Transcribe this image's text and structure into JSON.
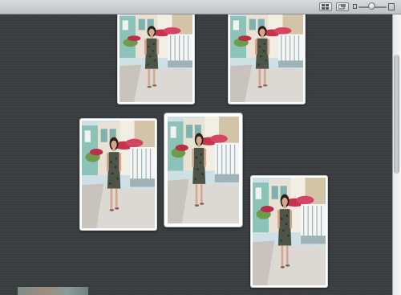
{
  "window": {
    "toolbar_buttons": [
      {
        "name": "view-mode-button",
        "icon": "grid-icon"
      },
      {
        "name": "stack-view-button",
        "icon": "stack-icon"
      }
    ],
    "zoom_slider": {
      "value": 0.45,
      "min_icon": "small-photo-icon",
      "max_icon": "large-photo-icon"
    }
  },
  "photos": [
    {
      "id": "photo-1",
      "subject": "woman-in-dress-walking",
      "selected": false
    },
    {
      "id": "photo-2",
      "subject": "woman-in-dress-walking",
      "selected": false
    },
    {
      "id": "photo-3",
      "subject": "woman-in-dress-walking",
      "selected": false
    },
    {
      "id": "photo-4",
      "subject": "woman-in-dress-walking",
      "selected": true
    },
    {
      "id": "photo-5",
      "subject": "woman-in-dress-walking",
      "selected": false
    }
  ],
  "scrollbar": {
    "position": 0.15
  },
  "colors": {
    "canvas": "#3b3e40",
    "toolbar": "#cfd2d5",
    "photo_border": "#ffffff",
    "sky": "#cfe0e8",
    "building": "#7fb7b0",
    "flowers": "#c5334e",
    "dress": "#4b5247",
    "sidewalk": "#d9d6d3"
  }
}
